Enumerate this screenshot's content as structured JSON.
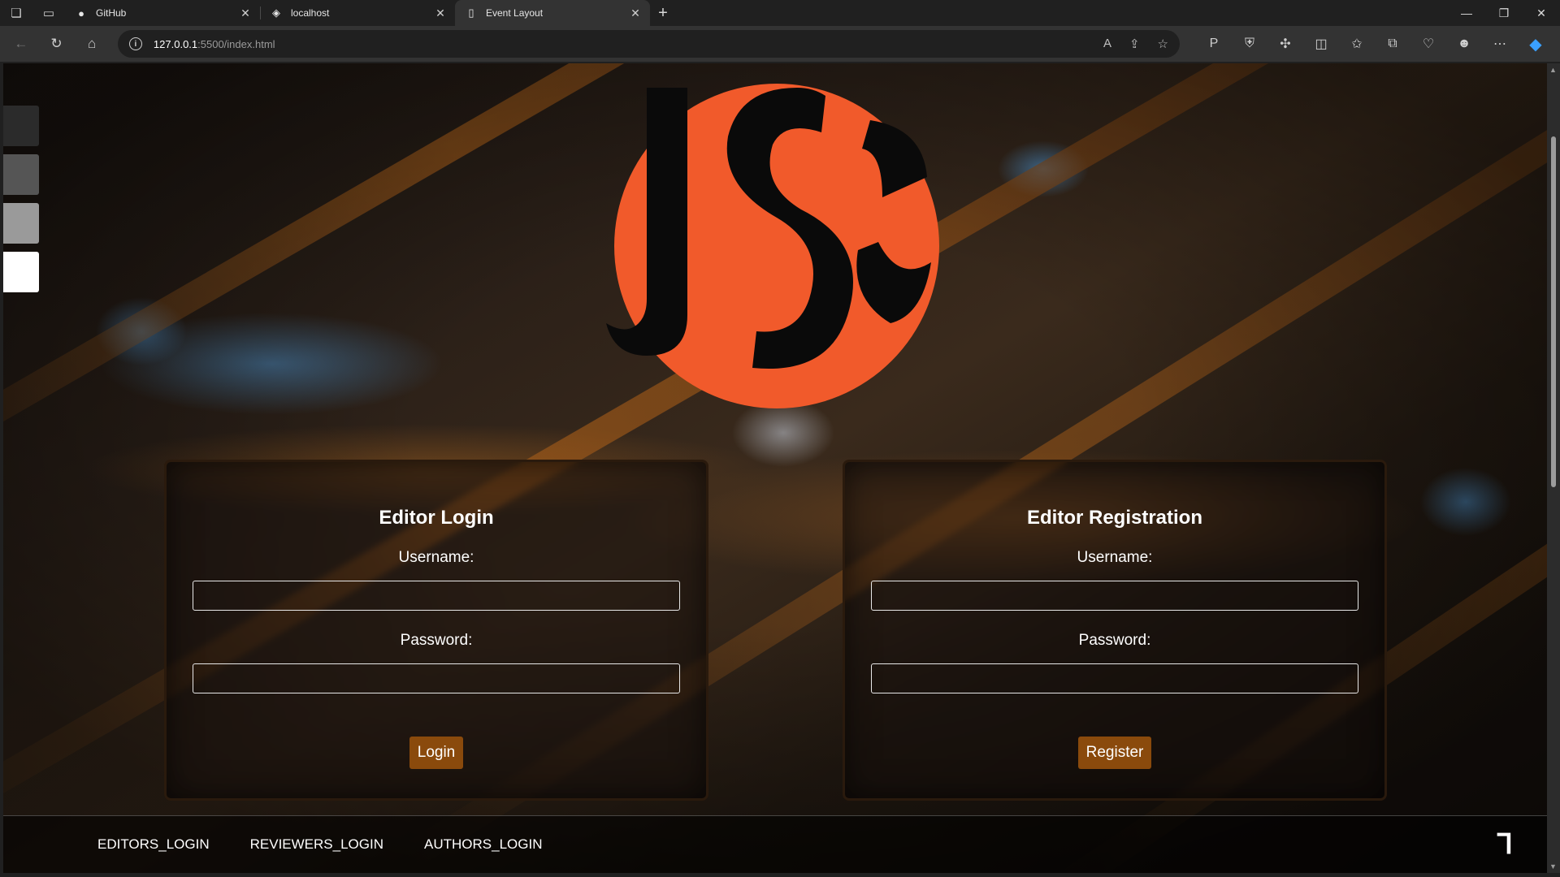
{
  "browser": {
    "tabs": [
      {
        "title": "GitHub",
        "icon": "github-icon"
      },
      {
        "title": "localhost",
        "icon": "page-icon"
      },
      {
        "title": "Event Layout",
        "icon": "document-icon",
        "active": true
      }
    ],
    "url_host": "127.0.0.1",
    "url_path": ":5500/index.html"
  },
  "swatches": [
    "#2b2b2b",
    "#555555",
    "#9a9a9a",
    "#ffffff"
  ],
  "logo": {
    "colors": {
      "orange": "#f15a2b",
      "black": "#0a0a0a"
    }
  },
  "login": {
    "title": "Editor Login",
    "username_label": "Username:",
    "password_label": "Password:",
    "username_value": "",
    "password_value": "",
    "button": "Login"
  },
  "register": {
    "title": "Editor Registration",
    "username_label": "Username:",
    "password_label": "Password:",
    "username_value": "",
    "password_value": "",
    "button": "Register"
  },
  "footer": {
    "links": [
      "EDITORS_LOGIN",
      "REVIEWERS_LOGIN",
      "AUTHORS_LOGIN"
    ],
    "mark": "Ꞁ"
  },
  "colors": {
    "button": "#8a4a0c",
    "accent_orange": "#f15a2b"
  }
}
